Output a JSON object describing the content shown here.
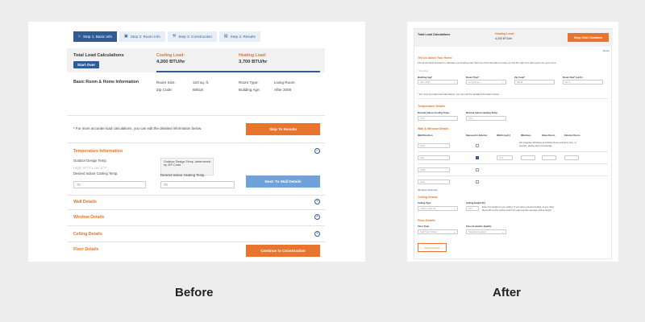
{
  "before": {
    "tabs": [
      {
        "label": "Step 1: Basic Info"
      },
      {
        "label": "Step 2: Room Info"
      },
      {
        "label": "Step 3: Construction"
      },
      {
        "label": "Step 4: Results"
      }
    ],
    "summary": {
      "title": "Total Load Calculations",
      "start_button": "Start Over",
      "cooling_label": "Cooling Load:",
      "cooling_value": "4,200 BTU/hr",
      "heating_label": "Heating Load:",
      "heating_value": "3,700 BTU/hr"
    },
    "room": {
      "title": "Basic Room & Home Information",
      "room_size_label": "Room Size:",
      "room_size_value": "120 sq. ft.",
      "room_type_label": "Room Type:",
      "room_type_value": "Living Room",
      "zip_label": "Zip Code:",
      "zip_value": "60618",
      "building_age_label": "Building Age:",
      "building_age_value": "After 2000"
    },
    "note": "* For more accurate load calculations, you can edit the detailed information below.",
    "skip_button": "Skip To Results",
    "temperature": {
      "title": "Temperature Information",
      "outdoor_label": "Outdoor Design Temp.",
      "outdoor_hint": "High: 87°F  Low: 2°F",
      "cooling_label": "Desired Indoor Cooling Temp.",
      "cooling_value": "75",
      "tooltip": "Outdoor Design Temp. determined by ZIP Code.",
      "heating_label": "Desired Indoor Heating Temp.",
      "heating_value": "70",
      "next_button": "Next: To Wall Details"
    },
    "sections": [
      {
        "title": "Wall Details"
      },
      {
        "title": "Window Details"
      },
      {
        "title": "Ceiling Details"
      },
      {
        "title": "Floor Details"
      }
    ],
    "continue_button": "Continue to Construction",
    "caption": "Before"
  },
  "after": {
    "top": {
      "title": "Total Load Calculations",
      "heating_label": "Heating Load:",
      "heating_value": "4,200 BTU/hr",
      "shop_button": "Shop HVAC Solutions",
      "reset": "Reset"
    },
    "home": {
      "title": "Tell Us About Your Home",
      "desc": "Fill out the fields provided to calculate your heating load. We'll use this information to help you find the right mini split system for your home.",
      "required": "* Required",
      "fields": [
        {
          "label": "Building Age*",
          "value": "After 2000"
        },
        {
          "label": "Room Type*",
          "value": "Living Room"
        },
        {
          "label": "Zip Code*",
          "value": "60618"
        },
        {
          "label": "Room Size* (sq.ft.)",
          "value": "Sq. ft."
        }
      ],
      "note": "* For more accurate load calculations, you can edit the detailed information below."
    },
    "temp": {
      "title": "Temperature Details",
      "cooling_label": "Desired Indoor Cooling Temp.",
      "cooling_value": "75°F",
      "heating_label": "Desired Indoor Heating Temp.",
      "heating_value": "70°F"
    },
    "wall": {
      "title": "Wall & Window Details",
      "headers": [
        "Wall Direction",
        "Exposed to Exterior",
        "Width (sq.ft.)",
        "Windows",
        "Glass Doors",
        "Exterior Doors"
      ],
      "rows": [
        {
          "dir": "North",
          "width": "",
          "windows": "",
          "doors": ""
        },
        {
          "dir": "East",
          "width": "10 ft",
          "windows": "",
          "doors": ""
        },
        {
          "dir": "South",
          "width": "",
          "windows": "",
          "doors": ""
        },
        {
          "dir": "West",
          "width": "",
          "windows": "",
          "doors": ""
        }
      ],
      "hint": "We integrate Windows and Glass Doors and their size, or specific, please ask a knowledge.",
      "windows_link": "Windows (Optional)"
    },
    "ceiling": {
      "title": "Ceiling Details",
      "type_label": "Ceiling Type",
      "type_value": "Ceiling under flat",
      "height_label": "Ceiling Height (ft.)",
      "height_value": "10 ft.",
      "height_hint": "Enter the height of your ceiling. If you have a sloped ceiling, at any other layout fill out the ceiling under the approximate average ceiling height."
    },
    "floor": {
      "title": "Floor Details",
      "type_label": "Floor Type",
      "type_value": "Slab Type Surface",
      "insulation_label": "Floor Insulation Quality",
      "insulation_value": "Standard Insulation"
    },
    "reset_button": "Reset Results",
    "caption": "After"
  }
}
